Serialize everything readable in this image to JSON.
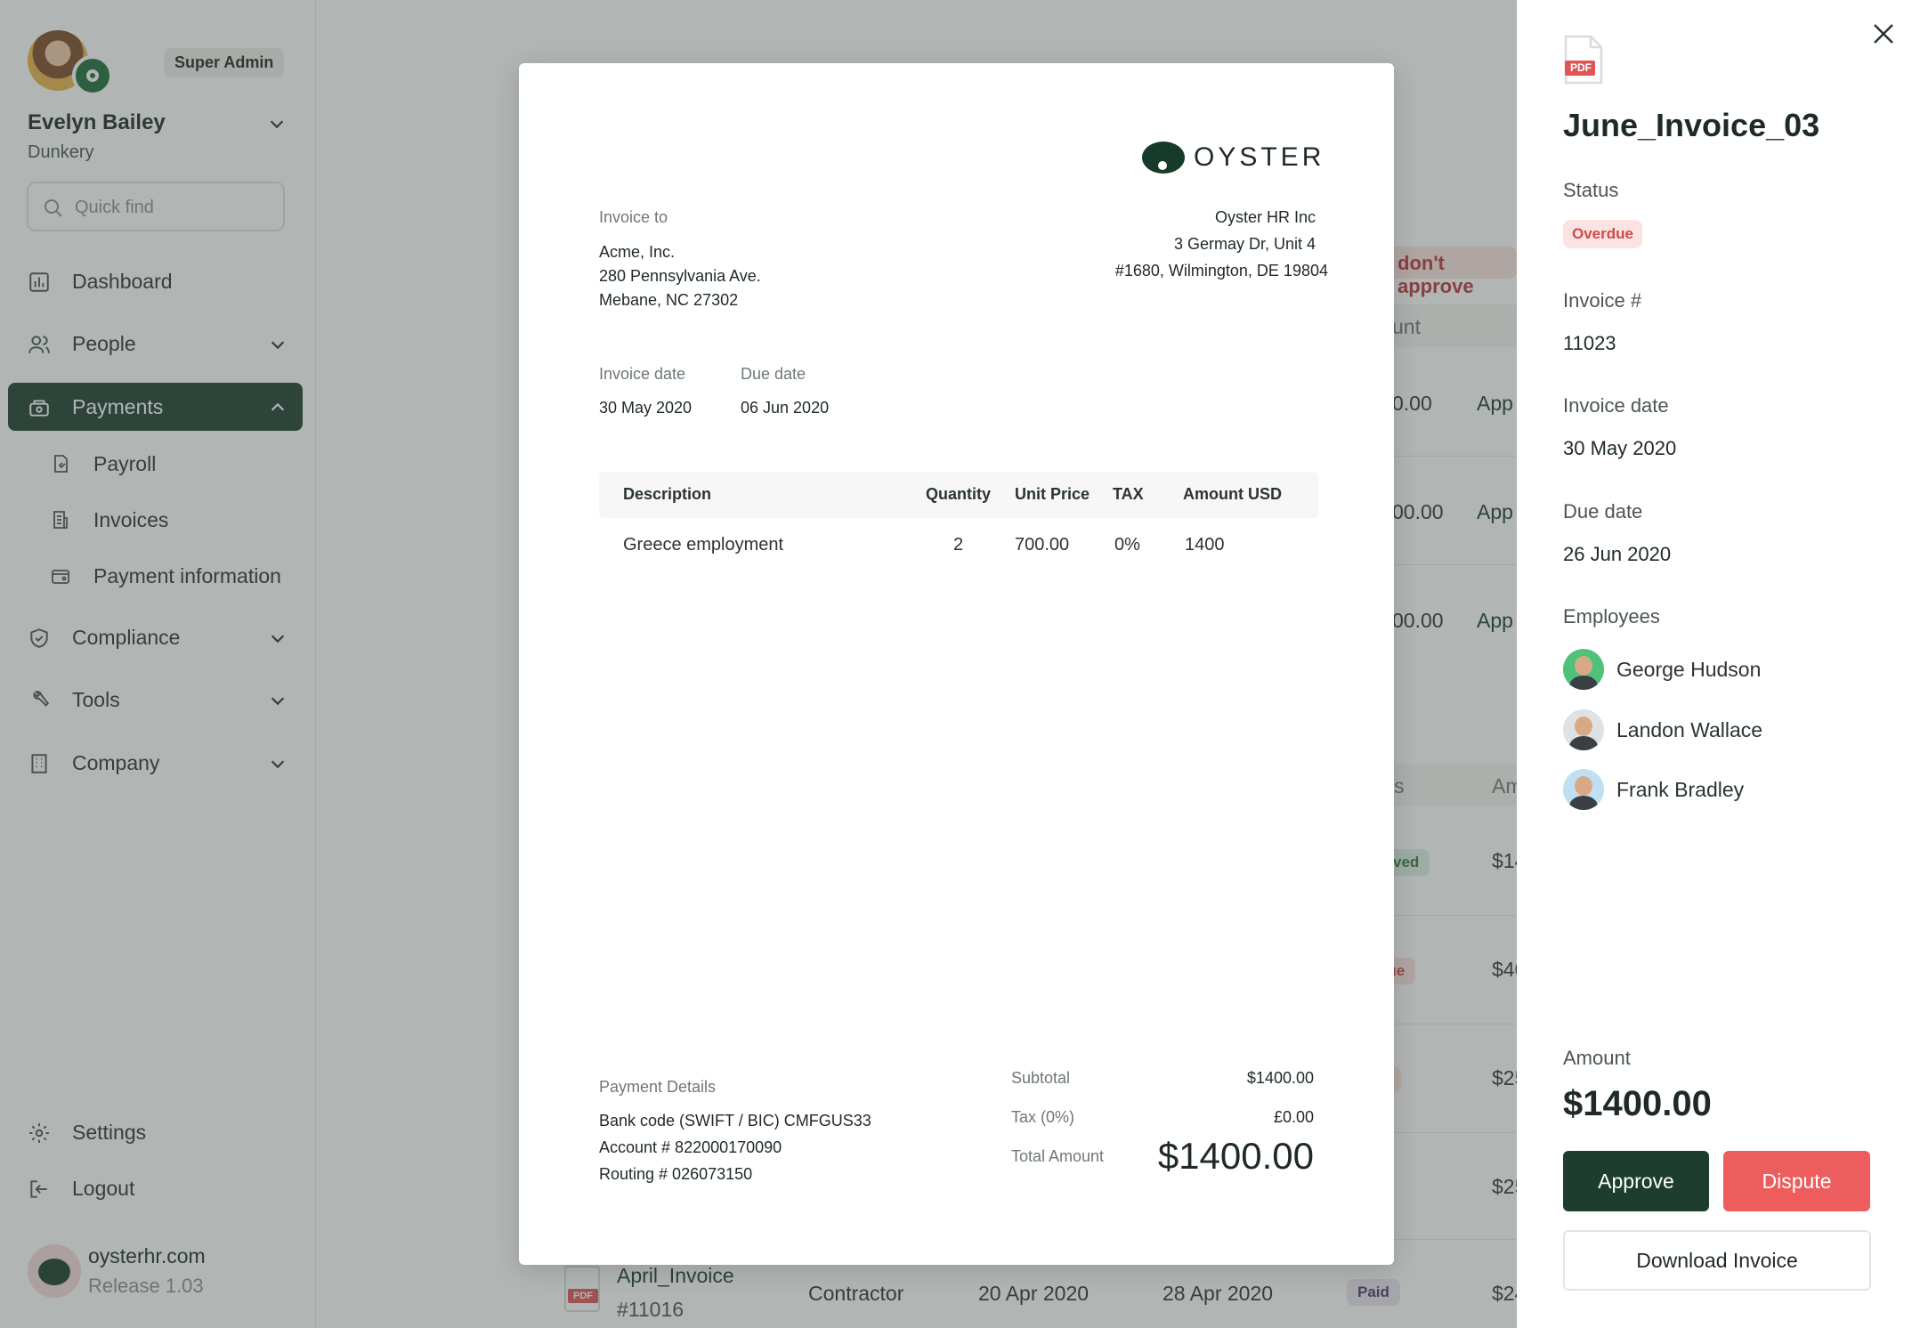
{
  "sidebar": {
    "role": "Super Admin",
    "user_name": "Evelyn Bailey",
    "company": "Dunkery",
    "search_placeholder": "Quick find",
    "nav": {
      "dashboard": "Dashboard",
      "people": "People",
      "payments": "Payments",
      "payroll": "Payroll",
      "invoices": "Invoices",
      "payment_information": "Payment information",
      "compliance": "Compliance",
      "tools": "Tools",
      "company": "Company",
      "settings": "Settings",
      "logout": "Logout"
    },
    "brand_name": "oysterhr.com",
    "release": "Release 1.03"
  },
  "background": {
    "banner_fragment": "don't approve",
    "col_amount_fragment": "unt",
    "amount_fragments": [
      "0.00",
      "00.00",
      "00.00"
    ],
    "approve_fragments": [
      "App",
      "App",
      "App"
    ],
    "col_status_fragment": "s",
    "col_amount2_fragment": "Am",
    "status_fragments": [
      "roved",
      "due",
      "al"
    ],
    "amount2_fragments": [
      "$14",
      "$40",
      "$25",
      "$25",
      "$24"
    ],
    "last_row": {
      "name": "April_Invoice",
      "number": "#11016",
      "type": "Contractor",
      "invoice_date": "20 Apr 2020",
      "due_date": "28 Apr 2020",
      "status": "Paid"
    }
  },
  "invoice": {
    "logo_text": "OYSTER",
    "invoice_to_label": "Invoice to",
    "to_name": "Acme, Inc.",
    "to_address_1": "280 Pennsylvania Ave.",
    "to_address_2": "Mebane, NC 27302",
    "from_name": "Oyster HR Inc",
    "from_address_1": "3 Germay Dr, Unit 4",
    "from_address_2": "#1680, Wilmington, DE 19804",
    "invoice_date_label": "Invoice date",
    "invoice_date": "30 May 2020",
    "due_date_label": "Due date",
    "due_date": "06 Jun 2020",
    "table": {
      "headers": [
        "Description",
        "Quantity",
        "Unit Price",
        "TAX",
        "Amount USD"
      ],
      "rows": [
        [
          "Greece employment",
          "2",
          "700.00",
          "0%",
          "1400"
        ]
      ]
    },
    "payment_details_label": "Payment Details",
    "bank_code": "Bank code (SWIFT / BIC) CMFGUS33",
    "account": "Account #  822000170090",
    "routing": "Routing # 026073150",
    "subtotal_label": "Subtotal",
    "subtotal": "$1400.00",
    "tax_label": "Tax (0%)",
    "tax": "£0.00",
    "total_label": "Total Amount",
    "total": "$1400.00"
  },
  "panel": {
    "file_badge": "PDF",
    "title": "June_Invoice_03",
    "status_label": "Status",
    "status": "Overdue",
    "invoice_number_label": "Invoice #",
    "invoice_number": "11023",
    "invoice_date_label": "Invoice date",
    "invoice_date": "30 May 2020",
    "due_date_label": "Due date",
    "due_date": "26 Jun 2020",
    "employees_label": "Employees",
    "employees": [
      "George Hudson",
      "Landon Wallace",
      "Frank Bradley"
    ],
    "amount_label": "Amount",
    "amount": "$1400.00",
    "approve": "Approve",
    "dispute": "Dispute",
    "download": "Download Invoice"
  },
  "colors": {
    "primary": "#1d3d2f",
    "danger": "#ee5d5d",
    "overdue_bg": "#fbe3e3",
    "overdue_text": "#d24848"
  }
}
